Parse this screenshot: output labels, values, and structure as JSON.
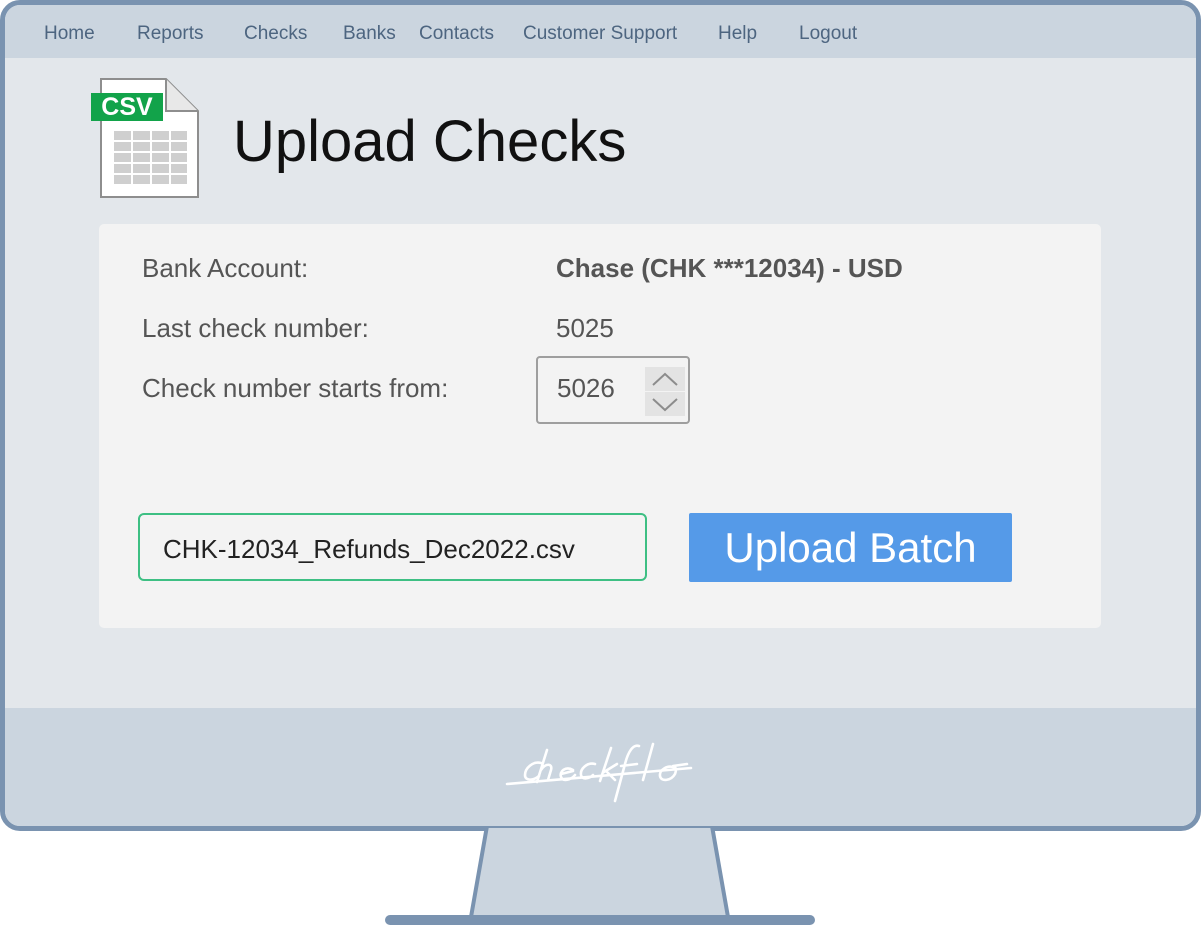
{
  "nav": {
    "items": [
      {
        "label": "Home"
      },
      {
        "label": "Reports"
      },
      {
        "label": "Checks"
      },
      {
        "label": "Banks"
      },
      {
        "label": "Contacts"
      },
      {
        "label": "Customer Support"
      },
      {
        "label": "Help"
      },
      {
        "label": "Logout"
      }
    ]
  },
  "header": {
    "title": "Upload Checks",
    "icon_badge": "CSV",
    "icon": "csv-file-icon"
  },
  "form": {
    "bank_account_label": "Bank Account:",
    "bank_account_value": "Chase (CHK ***12034) - USD",
    "last_check_label": "Last check number:",
    "last_check_value": "5025",
    "start_from_label": "Check number starts from:",
    "start_from_value": "5026",
    "file_name": "CHK-12034_Refunds_Dec2022.csv",
    "upload_label": "Upload Batch"
  },
  "brand": {
    "name": "checkflo"
  },
  "colors": {
    "accent": "#559ae8",
    "file_border": "#3dbf83",
    "csv_badge": "#12a34a",
    "frame": "#7a93b0",
    "nav_bg": "#cbd5df"
  }
}
